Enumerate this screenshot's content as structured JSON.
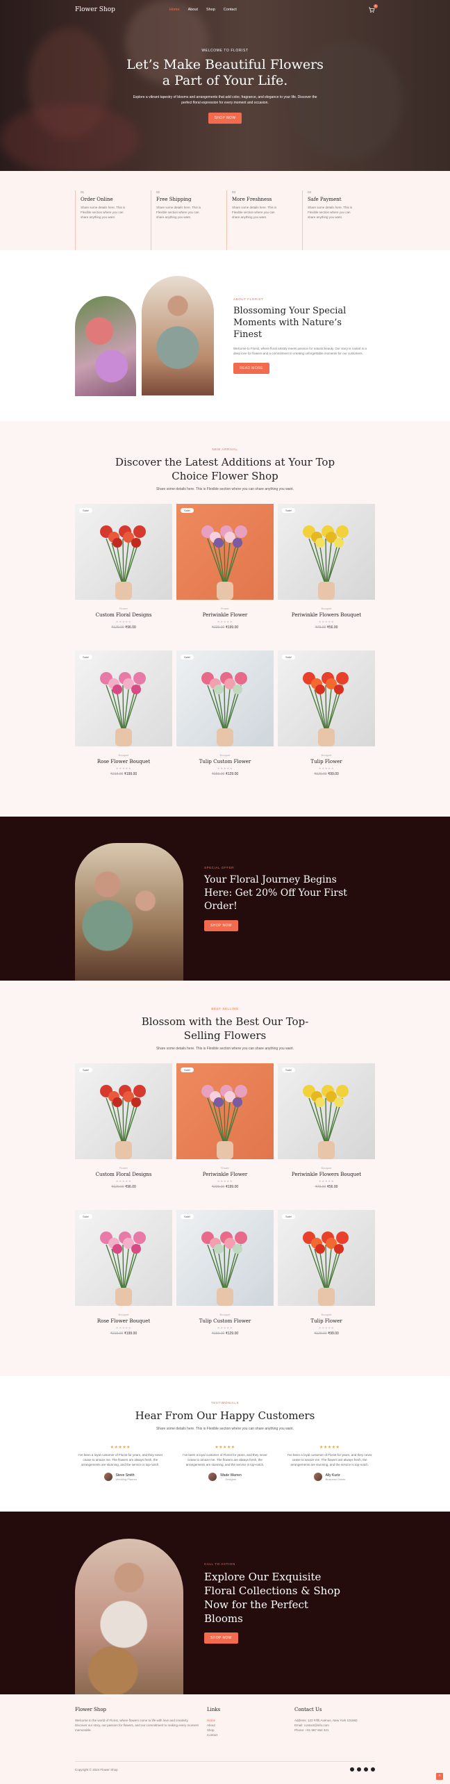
{
  "nav": {
    "logo": "Flower Shop",
    "items": [
      {
        "label": "Home"
      },
      {
        "label": "About"
      },
      {
        "label": "Shop"
      },
      {
        "label": "Contact"
      }
    ],
    "cart_count": "0"
  },
  "hero": {
    "eyebrow": "WELCOME TO FLORIST",
    "title": "Let’s Make Beautiful Flowers a Part of Your Life.",
    "text": "Explore a vibrant tapestry of blooms and arrangements that add color, fragrance, and elegance to your life. Discover the perfect floral expression for every moment and occasion.",
    "button": "SHOP NOW"
  },
  "features": [
    {
      "num": "01",
      "title": "Order Online",
      "text": "Share some details here. This is Flexible section where you can share anything you want."
    },
    {
      "num": "02",
      "title": "Free Shipping",
      "text": "Share some details here. This is Flexible section where you can share anything you want."
    },
    {
      "num": "03",
      "title": "More Freshness",
      "text": "Share some details here. This is Flexible section where you can share anything you want."
    },
    {
      "num": "04",
      "title": "Safe Payment",
      "text": "Share some details here. This is Flexible section where you can share anything you want."
    }
  ],
  "about": {
    "tag": "ABOUT FLORIST",
    "title": "Blossoming Your Special Moments with Nature’s Finest",
    "text": "Welcome to Florist, where floral artistry meets passion for natural beauty. Our story is rooted in a deep love for flowers and a commitment to creating unforgettable moments for our customers.",
    "button": "READ MORE"
  },
  "new_arrivals": {
    "tag": "NEW ARRIVAL",
    "title": "Discover the Latest Additions at Your Top Choice Flower Shop",
    "text": "Share some details here. This is Flexible section where you can share anything you want."
  },
  "products": [
    {
      "sale": "Sale!",
      "cat": "Flower",
      "name": "Custom Floral Designs",
      "stars": "★★★★★",
      "old": "₹129.00",
      "new": "₹96.00",
      "c1": "#d9d9d9",
      "c2": "#f2f2f2"
    },
    {
      "sale": "Sale!",
      "cat": "Flower",
      "name": "Periwinkle Flower",
      "stars": "★★★★★",
      "old": "₹229.00",
      "new": "₹199.00",
      "c1": "#e2764c",
      "c2": "#ee8a5e"
    },
    {
      "sale": "Sale!",
      "cat": "Bouquet",
      "name": "Periwinkle Flowers Bouquet",
      "stars": "★★★★★",
      "old": "₹79.00",
      "new": "₹56.00",
      "c1": "#d6d6d6",
      "c2": "#efefef"
    },
    {
      "sale": "Sale!",
      "cat": "Bouquet",
      "name": "Rose Flower Bouquet",
      "stars": "★★★★★",
      "old": "₹219.00",
      "new": "₹199.00",
      "c1": "#dcdcdc",
      "c2": "#f3f3f3"
    },
    {
      "sale": "Sale!",
      "cat": "Bouquet",
      "name": "Tulip Custom Flower",
      "stars": "★★★★★",
      "old": "₹159.00",
      "new": "₹129.00",
      "c1": "#cfd6dc",
      "c2": "#eef1f3"
    },
    {
      "sale": "Sale!",
      "cat": "Bouquet",
      "name": "Tulip Flower",
      "stars": "★★★★★",
      "old": "₹129.00",
      "new": "₹99.00",
      "c1": "#d8d8d8",
      "c2": "#f1f1f1"
    }
  ],
  "offer": {
    "tag": "SPECIAL OFFER",
    "title": "Your Floral Journey Begins Here: Get 20% Off Your First Order!",
    "button": "SHOP NOW"
  },
  "best_selling": {
    "tag": "BEST SELLING",
    "title": "Blossom with the Best Our Top-Selling Flowers",
    "text": "Share some details here. This is Flexible section where you can share anything you want."
  },
  "testimonials": {
    "tag": "TESTIMONIALS",
    "title": "Hear From Our Happy Customers",
    "text": "Share some details here. This is Flexible section where you can share anything you want.",
    "items": [
      {
        "stars": "★★★★★",
        "quote": "I’ve been a loyal customer of Florist for years, and they never cease to amaze me. The flowers are always fresh, the arrangements are stunning, and the service is top-notch.",
        "name": "Steve Smith",
        "role": "Wedding Planner"
      },
      {
        "stars": "★★★★★",
        "quote": "I’ve been a loyal customer of Florist for years, and they never cease to amaze me. The flowers are always fresh, the arrangements are stunning, and the service is top-notch.",
        "name": "Wade Warren",
        "role": "Designer"
      },
      {
        "stars": "★★★★★",
        "quote": "I’ve been a loyal customer of Florist for years, and they never cease to amaze me. The flowers are always fresh, the arrangements are stunning, and the service is top-notch.",
        "name": "Ally Kurtz",
        "role": "Business Owner"
      }
    ]
  },
  "cta": {
    "tag": "CALL TO ACTION",
    "title": "Explore Our Exquisite Floral Collections & Shop Now for the Perfect Blooms",
    "button": "SHOP NOW"
  },
  "footer": {
    "brand": "Flower Shop",
    "about": "Welcome to the world of Florist, where flowers come to life with love and creativity. Discover our story, our passion for flowers, and our commitment to making every moment memorable.",
    "links_title": "Links",
    "links": [
      "Home",
      "About",
      "Shop",
      "Contact"
    ],
    "contact_title": "Contact Us",
    "address": "Address: 123 Fifth Avenue, New York 101660",
    "email": "Email: contact@info.com",
    "phone": "Phone: +91 987 654 321",
    "copyright": "Copyright © 2024 Flower Shop"
  }
}
